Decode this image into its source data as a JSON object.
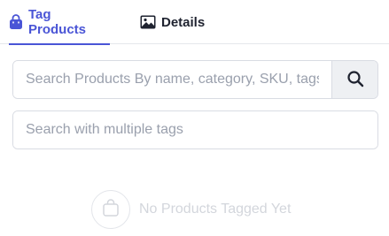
{
  "tabs": [
    {
      "label": "Tag Products",
      "icon": "shopping-bag-icon",
      "active": true
    },
    {
      "label": "Details",
      "icon": "image-icon",
      "active": false
    }
  ],
  "search": {
    "value": "",
    "placeholder": "Search Products By name, category, SKU, tags"
  },
  "tags": {
    "value": "",
    "placeholder": "Search with multiple tags"
  },
  "empty_state": {
    "text": "No Products Tagged Yet",
    "icon": "shopping-bag-icon"
  },
  "colors": {
    "accent": "#4a55d6",
    "text": "#1f2330",
    "placeholder": "#9aa0ad",
    "muted": "#d3d6dc"
  }
}
